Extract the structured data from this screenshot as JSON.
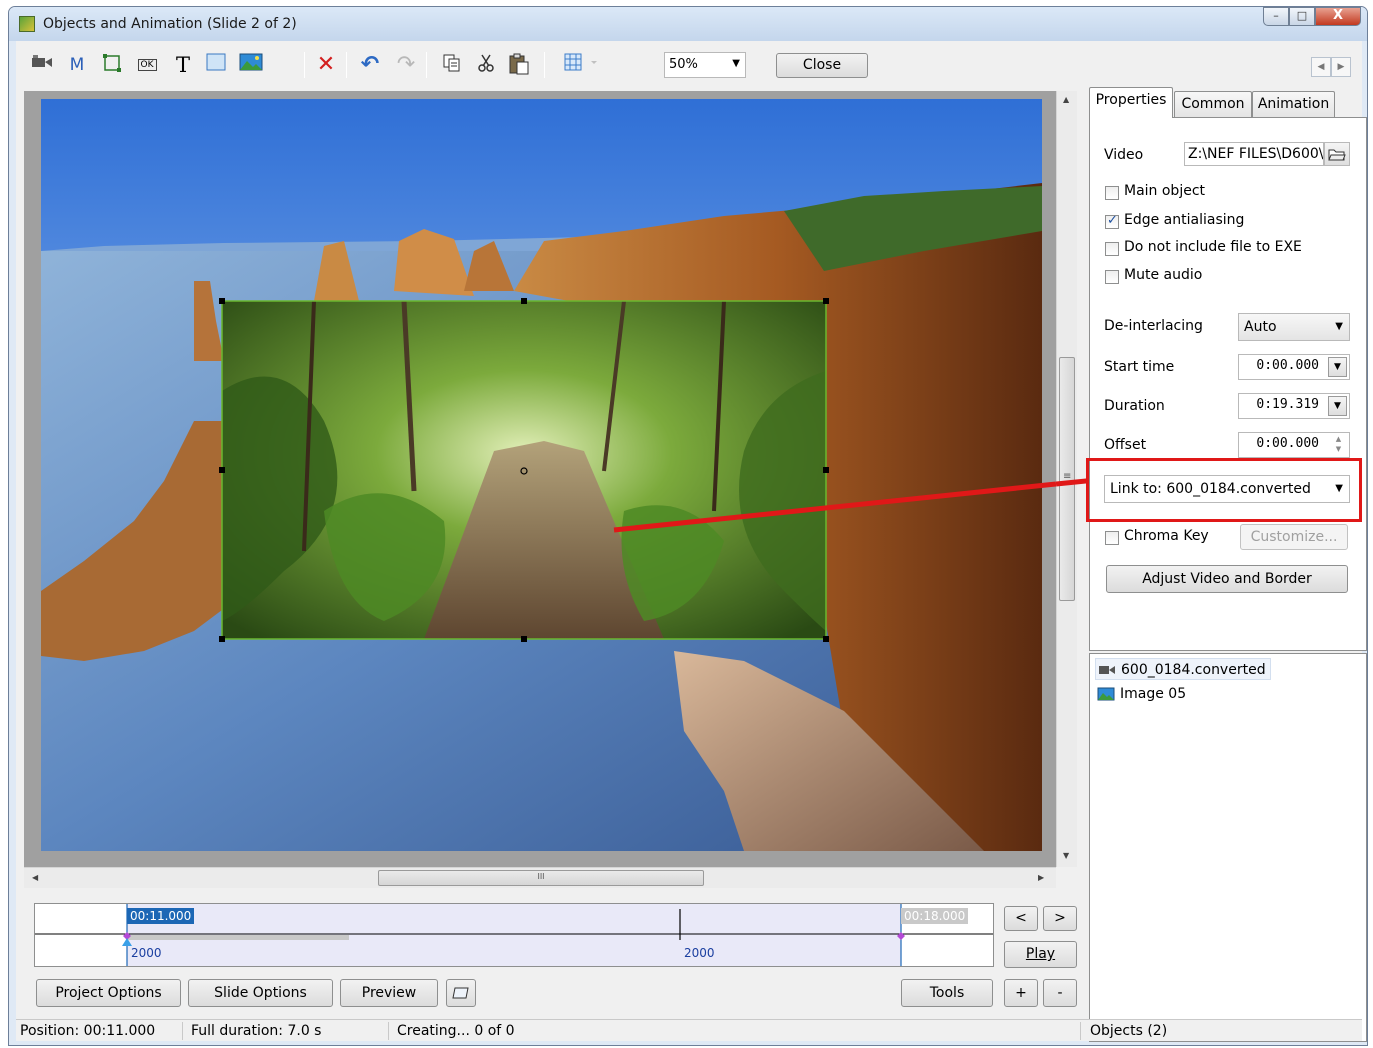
{
  "window": {
    "title": "Objects and Animation  (Slide 2 of 2)",
    "controls": {
      "minimize": "–",
      "maximize": "□",
      "close": "X"
    }
  },
  "toolbar": {
    "letter_m": "M",
    "letter_t": "T",
    "ok_icon_text": "OK",
    "delete_icon": "✕",
    "undo_icon": "↶",
    "redo_icon": "↷",
    "zoom_value": "50%",
    "close_label": "Close"
  },
  "canvas": {
    "background_image": "coastal cliffs seascape",
    "video_object": "forest path video frame",
    "red_pointer_color": "#e01818",
    "selection_color": "#6ab82f"
  },
  "scrollbar": {
    "grip": "III",
    "vgrip": "≡"
  },
  "timeline": {
    "start_time": "00:11.000",
    "end_time": "00:18.000",
    "marker_1": "2000",
    "marker_2": "2000",
    "accent": "#1c67b5"
  },
  "bottom_buttons": {
    "project_options": "Project Options",
    "slide_options": "Slide Options",
    "preview": "Preview",
    "tools": "Tools",
    "play": "Play",
    "prev": "<",
    "next": ">",
    "plus": "+",
    "minus": "-"
  },
  "panel": {
    "tabs": [
      "Properties",
      "Common",
      "Animation"
    ],
    "video_label": "Video",
    "video_path": "Z:\\NEF FILES\\D600\\",
    "checkboxes": [
      {
        "label": "Main object",
        "checked": false
      },
      {
        "label": "Edge antialiasing",
        "checked": true
      },
      {
        "label": "Do not include file to EXE",
        "checked": false
      },
      {
        "label": "Mute audio",
        "checked": false
      }
    ],
    "deinterlacing_label": "De-interlacing",
    "deinterlacing_value": "Auto",
    "start_time_label": "Start time",
    "start_time_value": "0:00.000",
    "duration_label": "Duration",
    "duration_value": "0:19.319",
    "offset_label": "Offset",
    "offset_value": "0:00.000",
    "link_value": "Link to: 600_0184.converted",
    "chroma_key_label": "Chroma Key",
    "customize_label": "Customize...",
    "adjust_label": "Adjust Video and Border",
    "highlight_color": "#e01818"
  },
  "objects": [
    {
      "name": "600_0184.converted",
      "icon": "video-camera-icon"
    },
    {
      "name": "Image 05",
      "icon": "image-icon"
    }
  ],
  "status": {
    "position": "Position:  00:11.000",
    "full_duration": "Full duration:  7.0 s",
    "creating": "Creating... 0 of 0",
    "objects_count": "Objects (2)"
  }
}
